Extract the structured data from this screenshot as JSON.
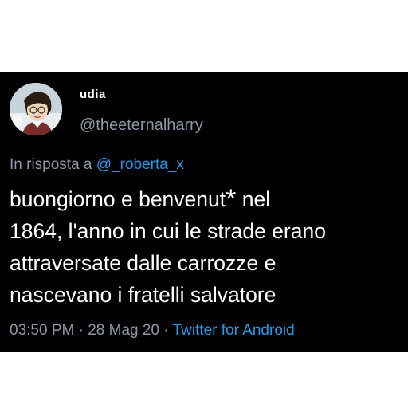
{
  "tweet": {
    "display_name": "udia",
    "handle": "@theeternalharry",
    "reply_prefix": "In risposta a",
    "reply_to": "@_roberta_x",
    "text_lines": {
      "line1_a": "buongiorno e benvenut",
      "line1_asterisk": "*",
      "line1_b": " nel",
      "line2": "1864, l'anno in cui le strade erano",
      "line3": "attraversate dalle carrozze e",
      "line4": "nascevano i fratelli salvatore"
    },
    "time": "03:50 PM",
    "separator1": " · ",
    "date": "28 Mag 20",
    "separator2": " · ",
    "source": "Twitter for Android"
  },
  "colors": {
    "background": "#000000",
    "text": "#ffffff",
    "secondary": "#8b98a5",
    "accent": "#1d9bf0"
  },
  "icons": {
    "avatar": "profile-avatar-cartoon"
  }
}
